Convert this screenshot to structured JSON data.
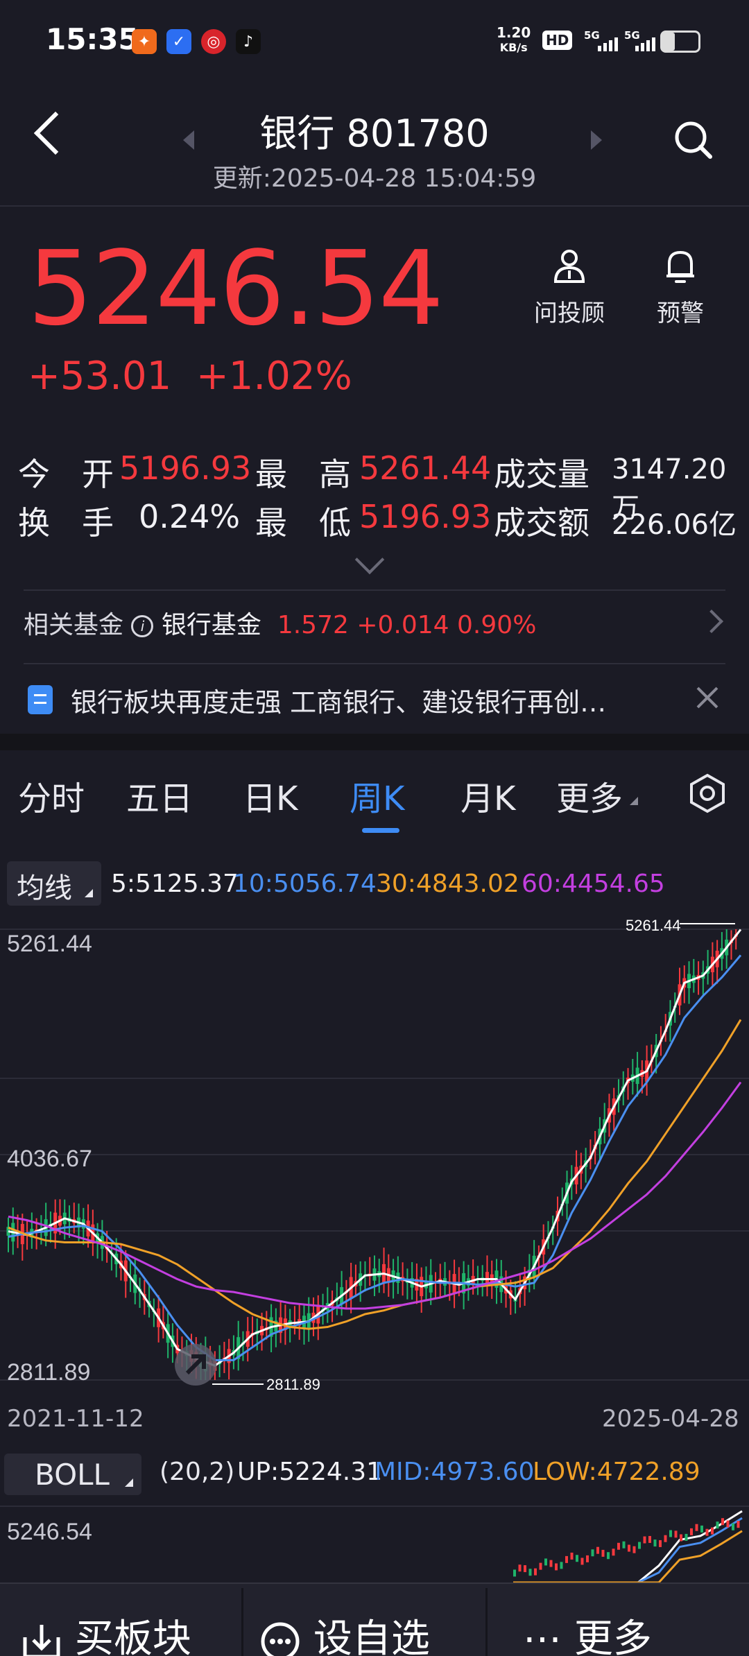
{
  "status_bar": {
    "time": "15:35",
    "net_speed": "1.20",
    "net_unit": "KB/s",
    "hd": "HD",
    "sim1": "5G",
    "sim2": "5G"
  },
  "header": {
    "title": "银行 801780",
    "updated": "更新:2025-04-28 15:04:59"
  },
  "quote": {
    "price": "5246.54",
    "change": "+53.01",
    "change_pct": "+1.02%",
    "advisor_label": "问投顾",
    "alert_label": "预警"
  },
  "stats": {
    "open_label": "今　开",
    "open_value": "5196.93",
    "high_label": "最　高",
    "high_value": "5261.44",
    "volume_label": "成交量",
    "volume_value": "3147.20万",
    "turnover_label": "换　手",
    "turnover_value": "0.24%",
    "low_label": "最　低",
    "low_value": "5196.93",
    "amount_label": "成交额",
    "amount_value": "226.06亿"
  },
  "fund": {
    "label": "相关基金",
    "info_icon": "i",
    "name": "银行基金",
    "price": "1.572",
    "change": "+0.014",
    "pct": "0.90%"
  },
  "news": {
    "text": "银行板块再度走强 工商银行、建设银行再创…"
  },
  "tabs": [
    "分时",
    "五日",
    "日K",
    "周K",
    "月K",
    "更多"
  ],
  "ma_legend": {
    "button": "均线",
    "ma5": "5:5125.37",
    "ma10": "10:5056.74",
    "ma30": "30:4843.02",
    "ma60": "60:4454.65"
  },
  "colors": {
    "red": "#f5393e",
    "green": "#1fb46a",
    "blue": "#3e8cf5",
    "ma5": "#ffffff",
    "ma10": "#4a8ff0",
    "ma30": "#f0a128",
    "ma60": "#c33fe0"
  },
  "chart_data": {
    "type": "candlestick",
    "y_tick_labels": [
      "5261.44",
      "4036.67",
      "2811.89"
    ],
    "ylim": [
      2811.89,
      5261.44
    ],
    "high_marker": "5261.44",
    "low_marker": "2811.89",
    "x_start_label": "2021-11-12",
    "x_end_label": "2025-04-28",
    "series": [
      {
        "name": "5",
        "values": [
          3620,
          3600,
          3640,
          3690,
          3660,
          3560,
          3440,
          3300,
          3150,
          2980,
          2930,
          2890,
          2960,
          3060,
          3100,
          3120,
          3130,
          3210,
          3290,
          3380,
          3390,
          3360,
          3320,
          3350,
          3330,
          3360,
          3360,
          3250,
          3430,
          3640,
          3890,
          4020,
          4250,
          4440,
          4490,
          4710,
          4970,
          5010,
          5130,
          5260
        ]
      },
      {
        "name": "10",
        "values": [
          3590,
          3610,
          3620,
          3640,
          3650,
          3620,
          3520,
          3400,
          3260,
          3110,
          2990,
          2920,
          2920,
          2990,
          3060,
          3100,
          3130,
          3180,
          3240,
          3300,
          3340,
          3360,
          3350,
          3340,
          3340,
          3330,
          3340,
          3320,
          3340,
          3490,
          3720,
          3900,
          4110,
          4300,
          4430,
          4580,
          4780,
          4900,
          5000,
          5120
        ]
      },
      {
        "name": "30",
        "values": [
          3640,
          3600,
          3570,
          3560,
          3560,
          3560,
          3550,
          3520,
          3490,
          3440,
          3370,
          3300,
          3230,
          3170,
          3130,
          3100,
          3090,
          3100,
          3130,
          3170,
          3190,
          3220,
          3240,
          3260,
          3290,
          3320,
          3330,
          3340,
          3370,
          3420,
          3520,
          3620,
          3740,
          3880,
          4000,
          4150,
          4300,
          4450,
          4600,
          4770
        ]
      },
      {
        "name": "60",
        "values": [
          3700,
          3680,
          3650,
          3610,
          3580,
          3550,
          3510,
          3460,
          3410,
          3360,
          3320,
          3300,
          3290,
          3270,
          3250,
          3230,
          3220,
          3210,
          3200,
          3200,
          3210,
          3220,
          3240,
          3260,
          3290,
          3320,
          3350,
          3380,
          3410,
          3460,
          3520,
          3580,
          3660,
          3740,
          3820,
          3920,
          4040,
          4160,
          4290,
          4430
        ]
      }
    ]
  },
  "boll": {
    "button": "BOLL",
    "params": "(20,2)",
    "up": "UP:5224.31",
    "mid": "MID:4973.60",
    "low": "LOW:4722.89",
    "y_top_label": "5246.54"
  },
  "bottom_bar": {
    "buy": "买板块",
    "watch": "设自选",
    "more": "更多"
  }
}
